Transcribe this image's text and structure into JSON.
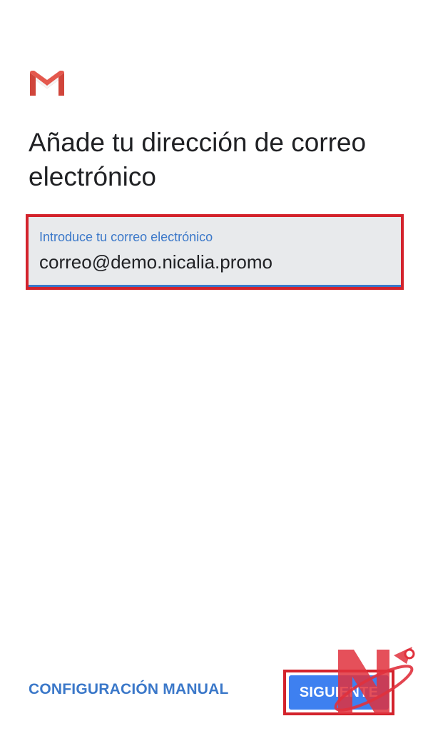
{
  "header": {
    "logo_icon": "gmail-logo-icon"
  },
  "main": {
    "title": "Añade tu dirección de correo electrónico",
    "email_field": {
      "label": "Introduce tu correo electrónico",
      "value": "correo@demo.nicalia.promo"
    }
  },
  "footer": {
    "manual_config_label": "CONFIGURACIÓN MANUAL",
    "next_label": "SIGUIENTE"
  },
  "watermark": {
    "icon": "nicalia-logo-icon"
  },
  "colors": {
    "accent": "#3b78c9",
    "button": "#3e80f0",
    "highlight": "#d3232c",
    "field_bg": "#e8eaec",
    "gmail_red": "#d0453b"
  }
}
